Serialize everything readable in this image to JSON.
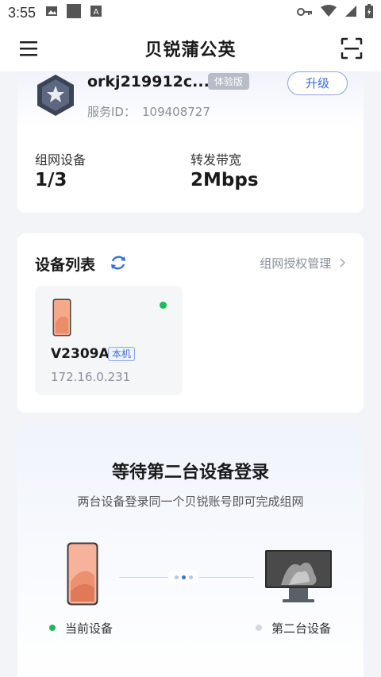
{
  "status_bar": {
    "time": "3:55"
  },
  "header": {
    "title": "贝锐蒲公英"
  },
  "account": {
    "name": "orkj219912c...",
    "trial_tag": "体验版",
    "upgrade_label": "升级",
    "service_id_label": "服务ID：",
    "service_id_value": "109408727",
    "stats": [
      {
        "label": "组网设备",
        "value": "1/3"
      },
      {
        "label": "转发带宽",
        "value": "2Mbps"
      }
    ]
  },
  "device_list": {
    "title": "设备列表",
    "auth_link": "组网授权管理",
    "devices": [
      {
        "model": "V2309A",
        "tag": "本机",
        "ip": "172.16.0.231",
        "online": true
      }
    ]
  },
  "waiting": {
    "title": "等待第二台设备登录",
    "subtitle": "两台设备登录同一个贝锐账号即可完成组网",
    "current_label": "当前设备",
    "second_label": "第二台设备"
  },
  "colors": {
    "accent": "#3b6fd8",
    "online": "#1fb85a",
    "muted": "#8a8f99"
  }
}
